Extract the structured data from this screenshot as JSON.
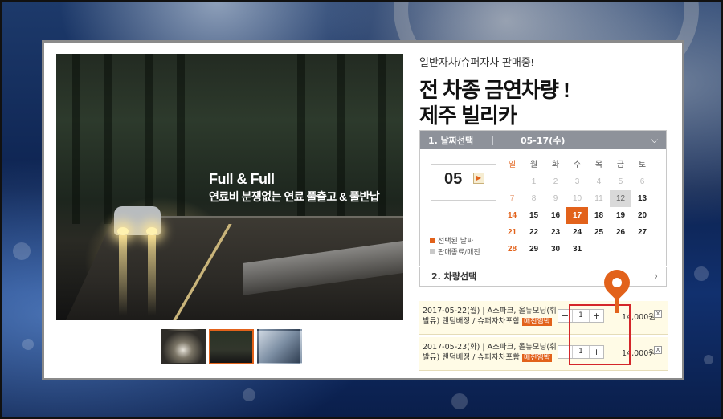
{
  "hero": {
    "title": "Full & Full",
    "subtitle": "연료비 분쟁없는 연료 풀출고 & 풀반납"
  },
  "thumbnails": [
    "thumb-1",
    "thumb-2",
    "thumb-3"
  ],
  "info": {
    "tagline": "일반자차/슈퍼자차 판매중!",
    "title_line1": "전 차종 금연차량 !",
    "title_line2": "제주 빌리카"
  },
  "calendar": {
    "step_label": "1. 날짜선택",
    "selected_date": "05-17(수)",
    "month": "05",
    "next_icon": "▶",
    "weekdays": [
      "일",
      "월",
      "화",
      "수",
      "목",
      "금",
      "토"
    ],
    "weeks": [
      [
        "",
        "1",
        "2",
        "3",
        "4",
        "5",
        "6"
      ],
      [
        "7",
        "8",
        "9",
        "10",
        "11",
        "12",
        "13"
      ],
      [
        "14",
        "15",
        "16",
        "17",
        "18",
        "19",
        "20"
      ],
      [
        "21",
        "22",
        "23",
        "24",
        "25",
        "26",
        "27"
      ],
      [
        "28",
        "29",
        "30",
        "31",
        "",
        "",
        ""
      ]
    ],
    "legend_selected": "선택된 날짜",
    "legend_closed": "판매종료/매진",
    "colors": {
      "accent": "#e2621b",
      "header": "#8e929a"
    }
  },
  "step2": {
    "label": "2. 차량선택"
  },
  "options": [
    {
      "desc": "2017-05-22(월) | A스파크, 올뉴모닝(휘발유) 랜덤배정 / 슈퍼자차포함",
      "badge": "매진임박",
      "qty": "1",
      "minus": "−",
      "plus": "+",
      "price": "14,000원",
      "delete": "X"
    },
    {
      "desc": "2017-05-23(화) | A스파크, 올뉴모닝(휘발유) 랜덤배정 / 슈퍼자차포함",
      "badge": "매진임박",
      "qty": "1",
      "minus": "−",
      "plus": "+",
      "price": "14,000원",
      "delete": "X"
    }
  ]
}
